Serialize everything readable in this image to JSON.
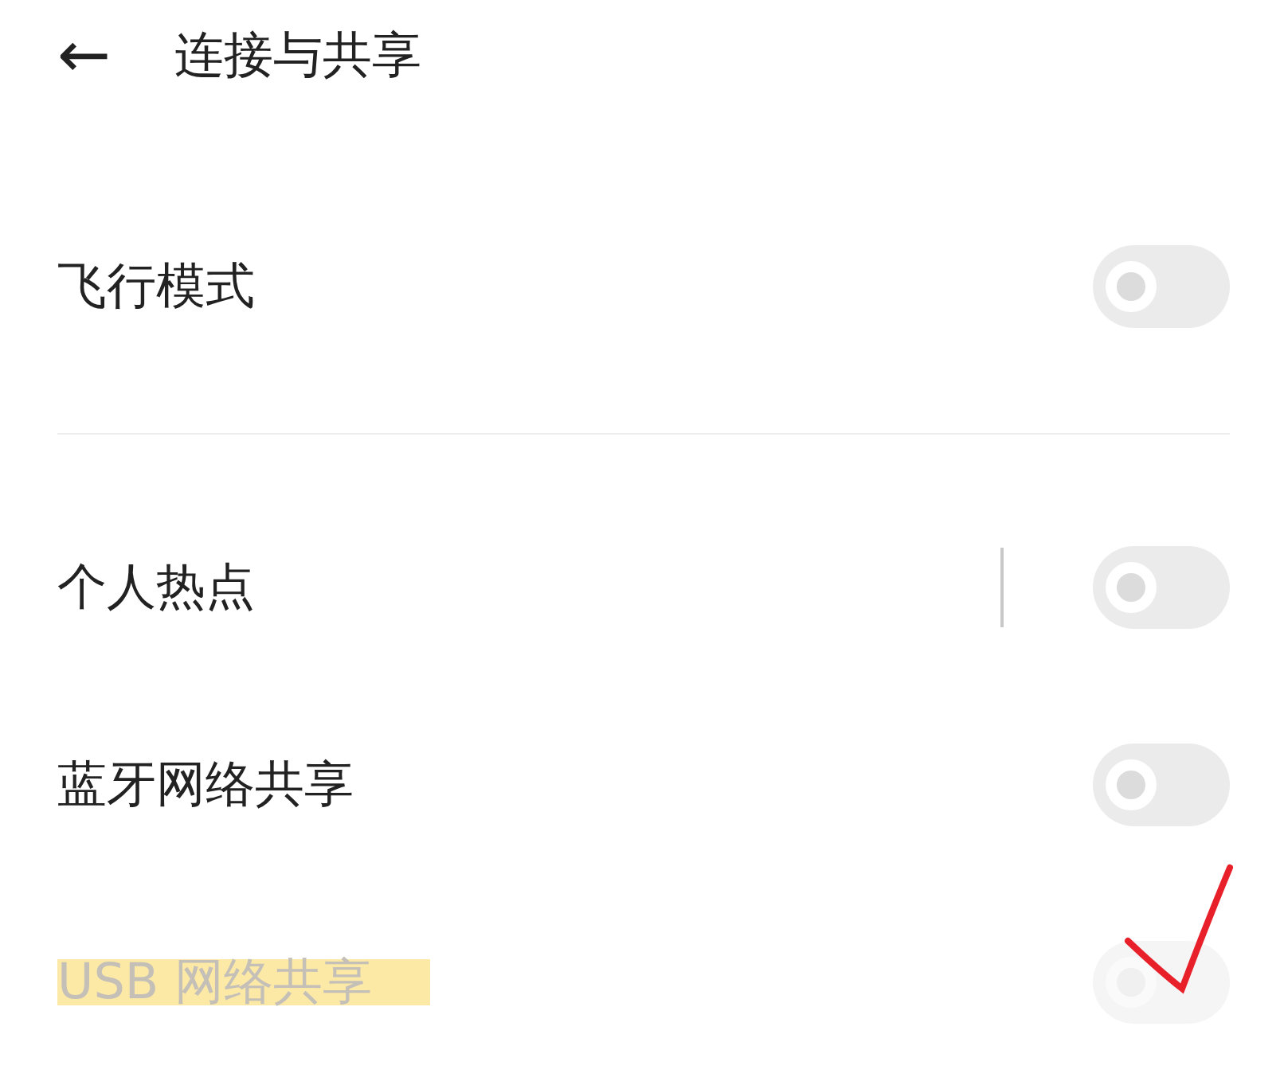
{
  "header": {
    "back": "←",
    "title": "连接与共享"
  },
  "sections": [
    {
      "rows": [
        {
          "label": "飞行模式",
          "on": false,
          "disabled": false,
          "separator": false,
          "highlighted": false,
          "annotated": false
        }
      ]
    },
    {
      "rows": [
        {
          "label": "个人热点",
          "on": false,
          "disabled": false,
          "separator": true,
          "highlighted": false,
          "annotated": false
        },
        {
          "label": "蓝牙网络共享",
          "on": false,
          "disabled": false,
          "separator": false,
          "highlighted": false,
          "annotated": false
        },
        {
          "label": "USB 网络共享",
          "on": false,
          "disabled": true,
          "separator": false,
          "highlighted": true,
          "annotated": true
        }
      ]
    }
  ]
}
